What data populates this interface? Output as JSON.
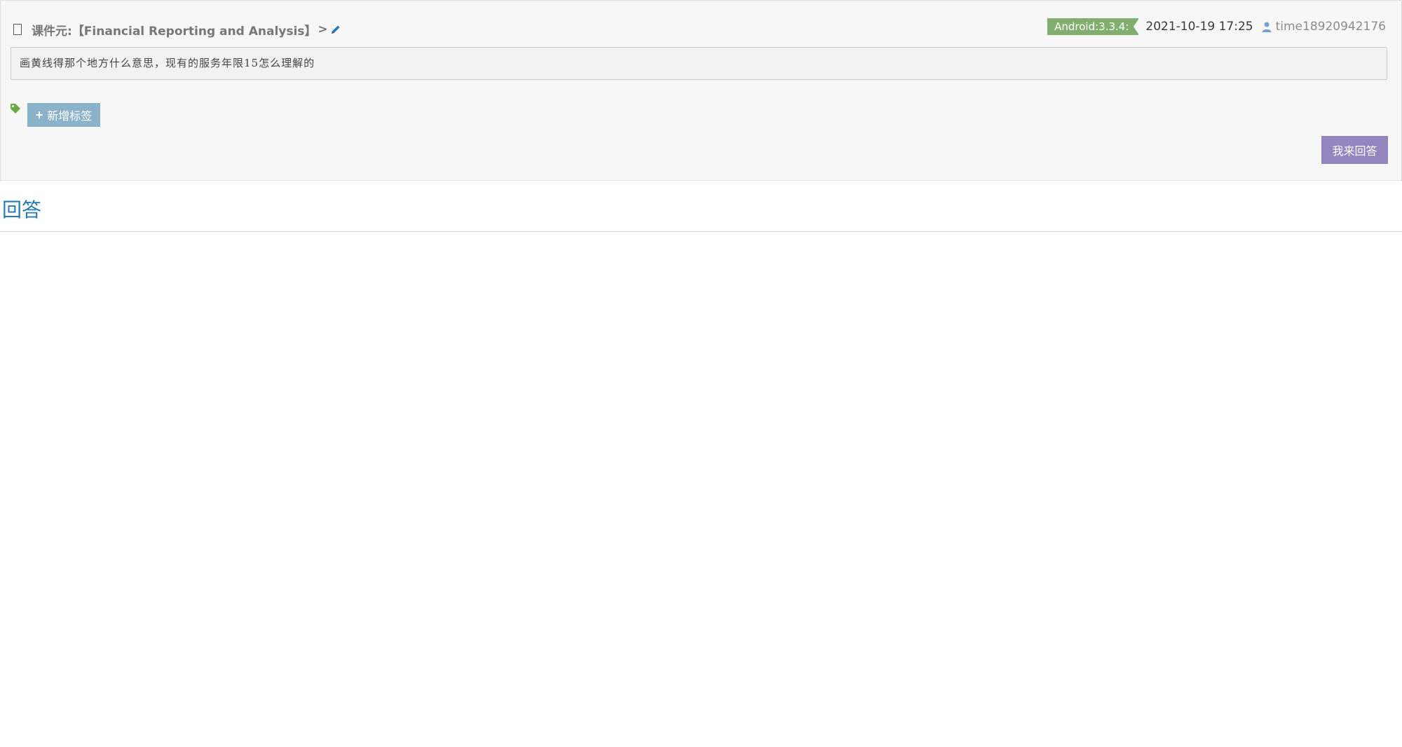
{
  "header": {
    "courseware_label": "课件元: ",
    "courseware_name": "【Financial Reporting and Analysis】",
    "arrow": ">"
  },
  "meta": {
    "version": "Android:3.3.4:",
    "datetime": "2021-10-19 17:25",
    "username": "time18920942176"
  },
  "question": {
    "text": "画黄线得那个地方什么意思，现有的服务年限15怎么理解的"
  },
  "tags": {
    "add_label": "新增标签"
  },
  "actions": {
    "answer_label": "我来回答"
  },
  "answers": {
    "title": "回答"
  },
  "colors": {
    "badge_green": "#82af6f",
    "add_tag_blue": "#8ab2c9",
    "answer_purple": "#9585bf",
    "title_blue": "#2679b5",
    "icon_blue": "#2679b5",
    "tag_green": "#69aa46"
  }
}
